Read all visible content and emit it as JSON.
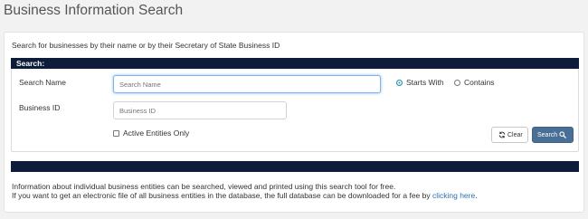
{
  "page": {
    "title": "Business Information Search"
  },
  "intro": "Search for businesses by their name or by their Secretary of State Business ID",
  "search_panel": {
    "header": "Search:",
    "search_name": {
      "label": "Search Name",
      "placeholder": "Search Name",
      "value": ""
    },
    "business_id": {
      "label": "Business ID",
      "placeholder": "Business ID",
      "value": ""
    },
    "match_options": [
      {
        "label": "Starts With",
        "selected": true
      },
      {
        "label": "Contains",
        "selected": false
      }
    ],
    "active_only": {
      "label": "Active Entities Only",
      "checked": false
    },
    "clear_button": {
      "label": "Clear",
      "icon": "refresh-icon"
    },
    "search_button": {
      "label": "Search",
      "icon": "search-icon"
    }
  },
  "info": {
    "line1": "Information about individual business entities can be searched, viewed and printed using this search tool for free.",
    "line2_prefix": "If you want to get an electronic file of all business entities in the database, the full database can be downloaded for a fee by ",
    "link_text": "clicking here",
    "line2_suffix": "."
  },
  "colors": {
    "header_bar": "#0e1c3a",
    "search_button": "#4a6f96",
    "link": "#2a6fb0",
    "radio_selected": "#1d8fb0"
  }
}
